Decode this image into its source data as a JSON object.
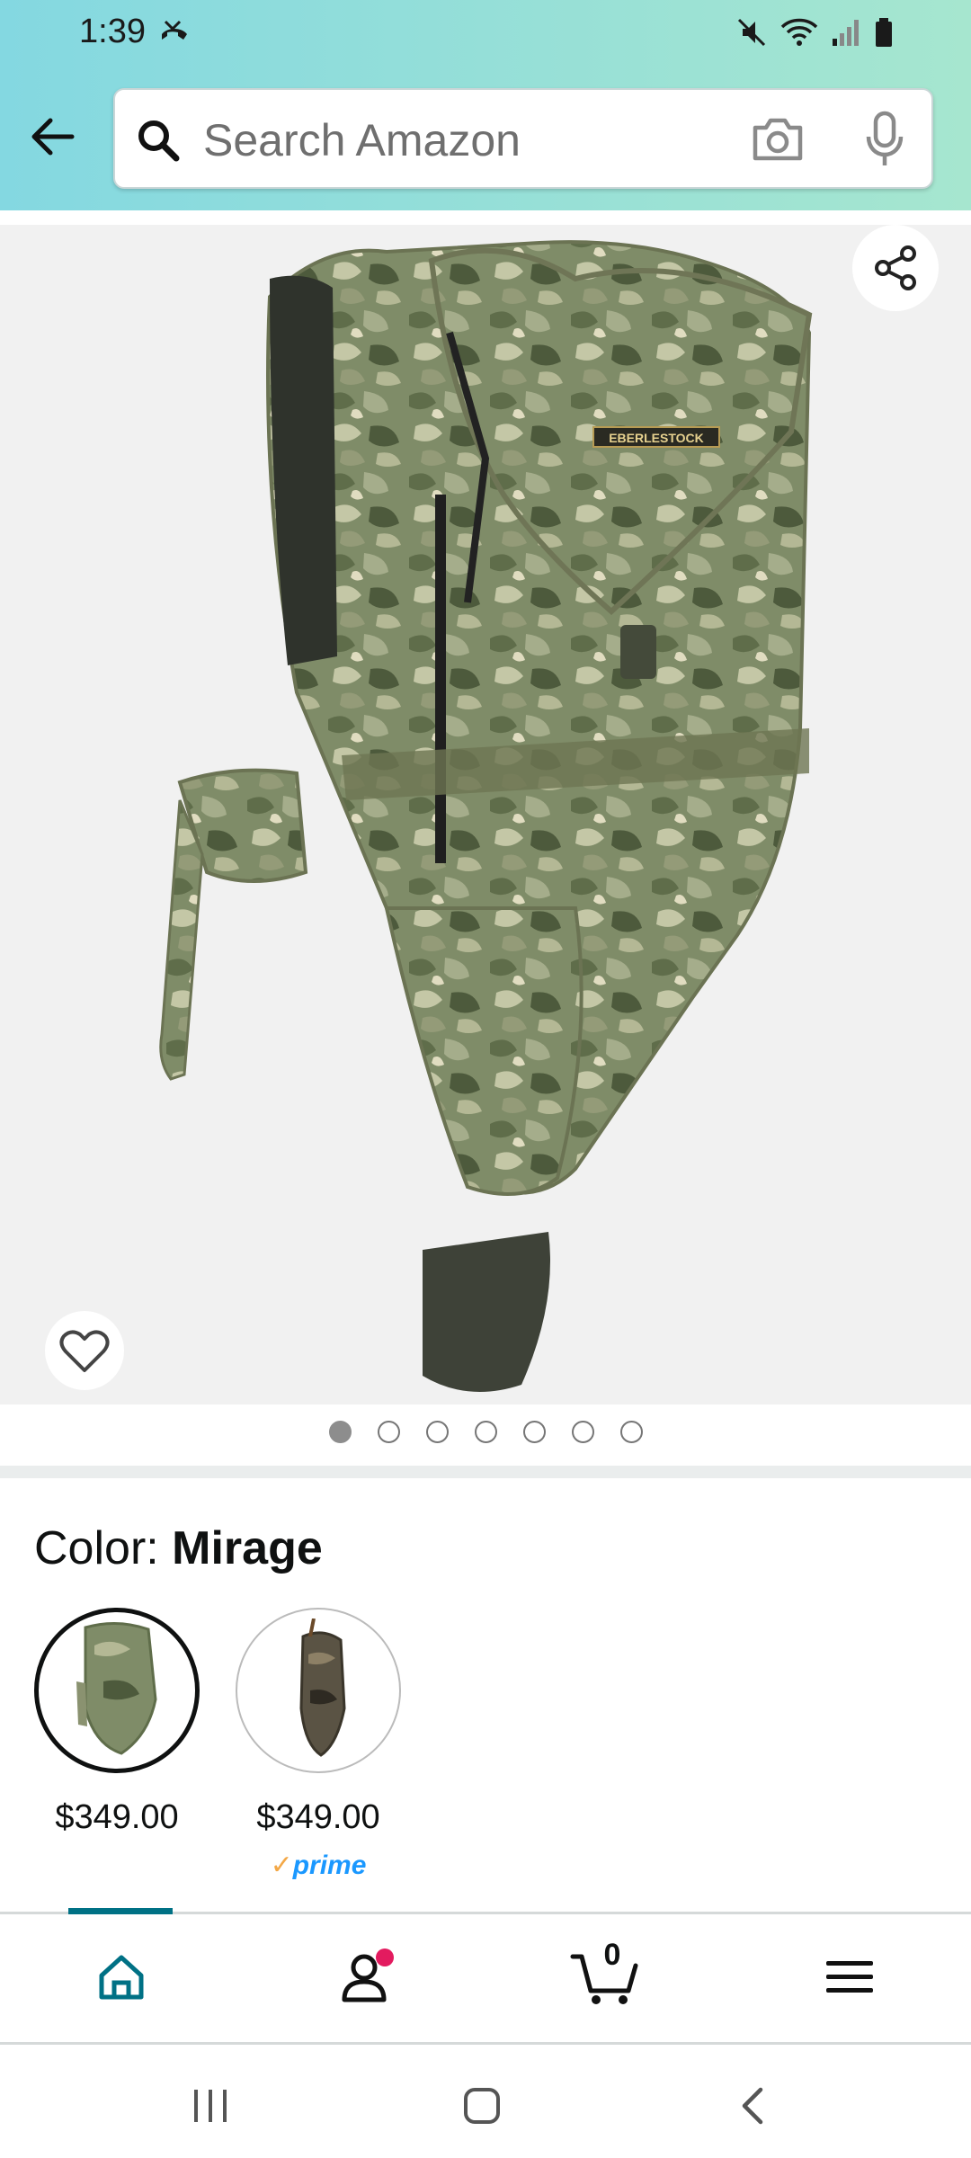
{
  "status_bar": {
    "time": "1:39",
    "left_icon": "missed-call-icon",
    "right_icons": [
      "mute-icon",
      "wifi-icon",
      "signal-icon",
      "battery-icon"
    ]
  },
  "search": {
    "placeholder": "Search Amazon",
    "icons": [
      "back-arrow-icon",
      "search-icon",
      "camera-icon",
      "mic-icon"
    ]
  },
  "product_image": {
    "brand_label": "EBERLESTOCK",
    "icons": [
      "share-icon",
      "heart-icon"
    ],
    "image_count": 7,
    "active_image_index": 0
  },
  "color": {
    "label": "Color: ",
    "selected_value": "Mirage",
    "options": [
      {
        "price": "$349.00",
        "prime": ""
      },
      {
        "price": "$349.00",
        "prime": "prime"
      }
    ]
  },
  "bottom_nav": {
    "cart_count": "0",
    "active_tab": "home",
    "icons": [
      "home-icon",
      "account-icon",
      "cart-icon",
      "menu-icon"
    ]
  },
  "system_nav": {
    "icons": [
      "recents-icon",
      "home-button-icon",
      "back-icon"
    ]
  },
  "colors": {
    "header_gradient_start": "#84d8e1",
    "header_gradient_end": "#a6e6cf",
    "nav_accent": "#007185",
    "prime_blue": "#1a98ff",
    "prime_check": "#f3a847",
    "notification_dot": "#e31b5f"
  }
}
